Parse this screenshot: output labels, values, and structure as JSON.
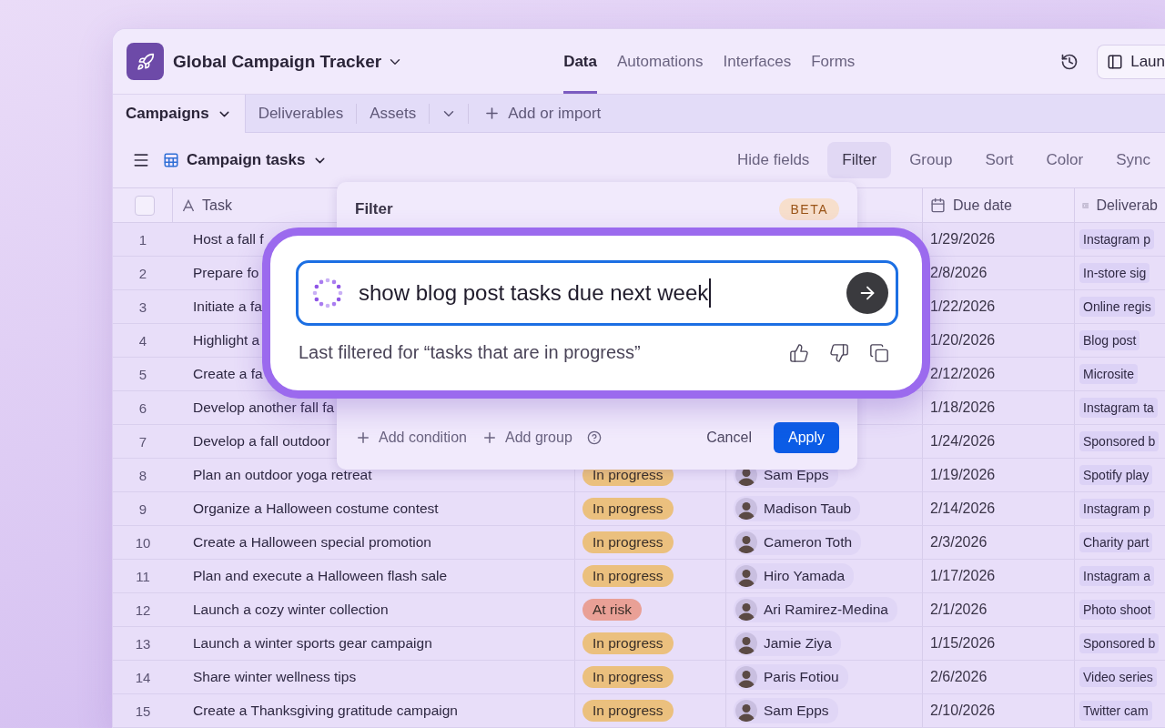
{
  "app": {
    "title": "Global Campaign Tracker"
  },
  "nav_tabs": [
    {
      "label": "Data",
      "selected": true
    },
    {
      "label": "Automations",
      "selected": false
    },
    {
      "label": "Interfaces",
      "selected": false
    },
    {
      "label": "Forms",
      "selected": false
    }
  ],
  "launch_button": {
    "label": "Laun"
  },
  "table_tabs": [
    {
      "label": "Campaigns",
      "selected": true
    },
    {
      "label": "Deliverables",
      "selected": false
    },
    {
      "label": "Assets",
      "selected": false
    }
  ],
  "add_table": {
    "label": "Add or import"
  },
  "view": {
    "name": "Campaign tasks"
  },
  "view_tools": [
    {
      "label": "Hide fields",
      "selected": false
    },
    {
      "label": "Filter",
      "selected": true
    },
    {
      "label": "Group",
      "selected": false
    },
    {
      "label": "Sort",
      "selected": false
    },
    {
      "label": "Color",
      "selected": false
    },
    {
      "label": "Sync",
      "selected": false
    }
  ],
  "table": {
    "select_all": {
      "checked": false
    },
    "columns": [
      {
        "kind": "text",
        "label": "Task"
      },
      {
        "kind": "date",
        "label": "Due date"
      },
      {
        "kind": "list",
        "label": "Deliverab"
      }
    ],
    "rows": [
      {
        "number": "1",
        "task": "Host a fall f",
        "due": "1/29/2026",
        "deliverables": [
          "Instagram p"
        ]
      },
      {
        "number": "2",
        "task": "Prepare fo",
        "due": "2/8/2026",
        "deliverables": [
          "In-store sig"
        ]
      },
      {
        "number": "3",
        "task": "Initiate a fa",
        "due": "1/22/2026",
        "deliverables": [
          "Online regis"
        ]
      },
      {
        "number": "4",
        "task": "Highlight a",
        "due": "1/20/2026",
        "deliverables": [
          "Blog post"
        ]
      },
      {
        "number": "5",
        "task": "Create a fa",
        "due": "2/12/2026",
        "deliverables": [
          "Microsite"
        ]
      },
      {
        "number": "6",
        "task": "Develop another fall fa",
        "due": "1/18/2026",
        "deliverables": [
          "Instagram ta"
        ]
      },
      {
        "number": "7",
        "task": "Develop a fall outdoor",
        "due": "1/24/2026",
        "deliverables": [
          "Sponsored b"
        ]
      },
      {
        "number": "8",
        "task": "Plan an outdoor yoga retreat",
        "status": {
          "label": "In progress",
          "color": "#ebc07e"
        },
        "assignee": "Sam Epps",
        "due": "1/19/2026",
        "deliverables": [
          "Spotify play"
        ]
      },
      {
        "number": "9",
        "task": "Organize a Halloween costume contest",
        "status": {
          "label": "In progress",
          "color": "#ebc07e"
        },
        "assignee": "Madison Taub",
        "due": "2/14/2026",
        "deliverables": [
          "Instagram p"
        ]
      },
      {
        "number": "10",
        "task": "Create a Halloween special promotion",
        "status": {
          "label": "In progress",
          "color": "#ebc07e"
        },
        "assignee": "Cameron Toth",
        "due": "2/3/2026",
        "deliverables": [
          "Charity part"
        ]
      },
      {
        "number": "11",
        "task": "Plan and execute a Halloween flash sale",
        "status": {
          "label": "In progress",
          "color": "#ebc07e"
        },
        "assignee": "Hiro Yamada",
        "due": "1/17/2026",
        "deliverables": [
          "Instagram a"
        ]
      },
      {
        "number": "12",
        "task": "Launch a cozy winter collection",
        "status": {
          "label": "At risk",
          "color": "#e9a096"
        },
        "assignee": "Ari Ramirez-Medina",
        "due": "2/1/2026",
        "deliverables": [
          "Photo shoot"
        ]
      },
      {
        "number": "13",
        "task": "Launch a winter sports gear campaign",
        "status": {
          "label": "In progress",
          "color": "#ebc07e"
        },
        "assignee": "Jamie Ziya",
        "due": "1/15/2026",
        "deliverables": [
          "Sponsored b"
        ]
      },
      {
        "number": "14",
        "task": "Share winter wellness tips",
        "status": {
          "label": "In progress",
          "color": "#ebc07e"
        },
        "assignee": "Paris Fotiou",
        "due": "2/6/2026",
        "deliverables": [
          "Video series"
        ]
      },
      {
        "number": "15",
        "task": "Create a Thanksgiving gratitude campaign",
        "status": {
          "label": "In progress",
          "color": "#ebc07e"
        },
        "assignee": "Sam Epps",
        "due": "2/10/2026",
        "deliverables": [
          "Twitter cam"
        ]
      }
    ]
  },
  "filter_popup": {
    "title": "Filter",
    "badge": "BETA",
    "actions": [
      "Add condition",
      "Add group"
    ],
    "cancel": "Cancel",
    "apply": "Apply"
  },
  "ai_prompt": {
    "value": "show blog post tasks due next week",
    "history": "Last filtered for “tasks that are in progress”"
  }
}
